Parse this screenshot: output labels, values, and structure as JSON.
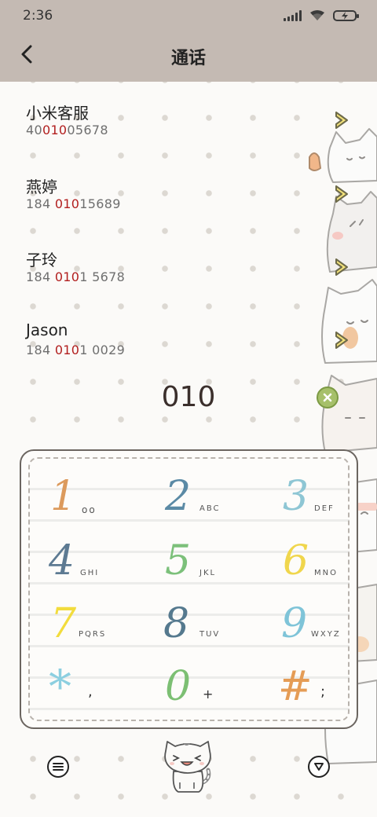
{
  "status_bar": {
    "time": "2:36"
  },
  "header": {
    "title": "通话"
  },
  "contacts": [
    {
      "name": "小米客服",
      "number_pre": "40",
      "number_hl": "010",
      "number_post": "05678"
    },
    {
      "name": "燕婷",
      "number_pre": "184 ",
      "number_hl": "010",
      "number_post": "15689"
    },
    {
      "name": "子玲",
      "number_pre": "184 ",
      "number_hl": "010",
      "number_post": "1 5678"
    },
    {
      "name": "Jason",
      "number_pre": "184 ",
      "number_hl": "010",
      "number_post": "1 0029"
    }
  ],
  "dial": {
    "number": "010"
  },
  "keypad": {
    "keys": [
      {
        "digit": "1",
        "letters": "oo",
        "color": "#dc9a5c"
      },
      {
        "digit": "2",
        "letters": "ABC",
        "color": "#5b8aa5"
      },
      {
        "digit": "3",
        "letters": "DEF",
        "color": "#8ec6d4"
      },
      {
        "digit": "4",
        "letters": "GHI",
        "color": "#5d7a92"
      },
      {
        "digit": "5",
        "letters": "JKL",
        "color": "#7cc07a"
      },
      {
        "digit": "6",
        "letters": "MNO",
        "color": "#f0d64c"
      },
      {
        "digit": "7",
        "letters": "PQRS",
        "color": "#f2dc3d"
      },
      {
        "digit": "8",
        "letters": "TUV",
        "color": "#55798e"
      },
      {
        "digit": "9",
        "letters": "WXYZ",
        "color": "#7fc4d8"
      },
      {
        "digit": "*",
        "letters": ",",
        "color": "#8ccfe0"
      },
      {
        "digit": "0",
        "letters": "+",
        "color": "#7cbf73"
      },
      {
        "digit": "#",
        "letters": ";",
        "color": "#e59c55"
      }
    ]
  },
  "icons": {
    "back": "chevron-left-icon",
    "contact_arrow": "chevron-right-icon",
    "clear": "clear-icon",
    "menu": "menu-icon",
    "collapse": "collapse-keypad-icon",
    "call": "cat-call-icon"
  }
}
